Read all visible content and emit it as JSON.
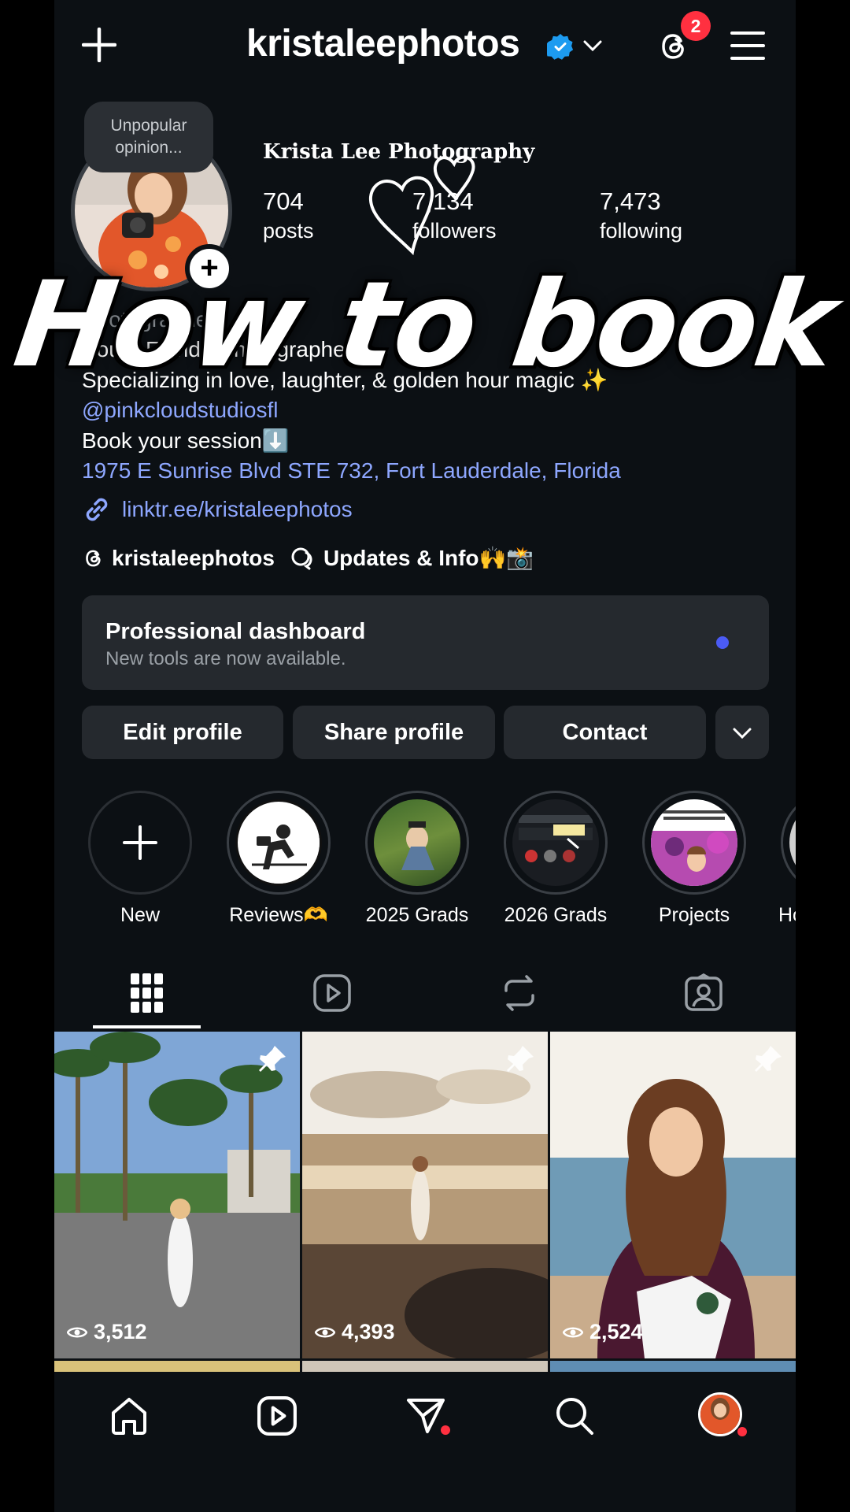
{
  "header": {
    "username": "kristaleephotos",
    "notification_count": "2",
    "icons": [
      "plus-icon",
      "verified-badge-icon",
      "chevron-down-icon",
      "threads-icon",
      "menu-icon"
    ]
  },
  "profile": {
    "note": "Unpopular opinion...",
    "display_name": "Krista Lee Photography",
    "stats": [
      {
        "value": "704",
        "label": "posts"
      },
      {
        "value": "7,134",
        "label": "followers"
      },
      {
        "value": "7,473",
        "label": "following"
      }
    ]
  },
  "bio": {
    "line1": "Photographer",
    "line2": "South Florida Photographer",
    "line3": "Specializing in love, laughter, & golden hour magic ✨",
    "mention": "@pinkcloudstudiosfl",
    "line5": "Book your session⬇️",
    "address": "1975 E Sunrise Blvd STE 732, Fort Lauderdale, Florida",
    "link": "linktr.ee/kristaleephotos"
  },
  "threads_row": {
    "threads_handle": "kristaleephotos",
    "channel": "Updates & Info🙌📸"
  },
  "dashboard": {
    "title": "Professional dashboard",
    "subtitle": "New tools are now available."
  },
  "buttons": {
    "edit": "Edit profile",
    "share": "Share profile",
    "contact": "Contact"
  },
  "highlights": [
    {
      "label": "New"
    },
    {
      "label": "Reviews🫶"
    },
    {
      "label": "2025 Grads"
    },
    {
      "label": "2026 Grads"
    },
    {
      "label": "Projects"
    },
    {
      "label": "Ho"
    }
  ],
  "posts": [
    {
      "views": "3,512"
    },
    {
      "views": "4,393"
    },
    {
      "views": "2,524"
    }
  ],
  "overlay_text": "How to book",
  "colors": {
    "background": "#0c1014",
    "surface": "#25292e",
    "link": "#8ea7ff",
    "verified": "#1d9bf0",
    "badge": "#ff3040",
    "dashboard_dot": "#4b5bf5"
  }
}
